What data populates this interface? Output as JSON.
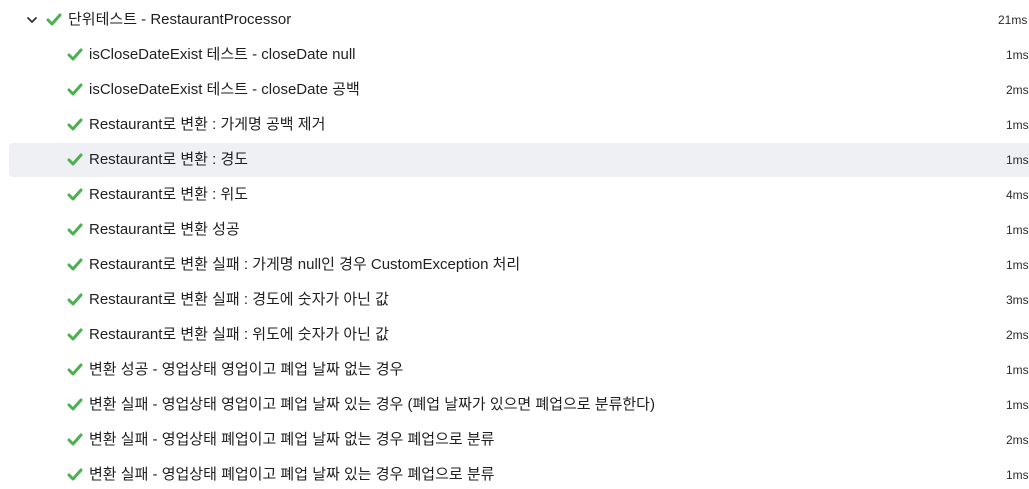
{
  "suite": {
    "title": "단위테스트 - RestaurantProcessor",
    "duration": "21ms",
    "status": "passed",
    "expanded": true
  },
  "tests": [
    {
      "name": "isCloseDateExist 테스트 - closeDate null",
      "duration": "1ms",
      "status": "passed"
    },
    {
      "name": "isCloseDateExist 테스트 - closeDate 공백",
      "duration": "2ms",
      "status": "passed"
    },
    {
      "name": "Restaurant로 변환 : 가게명 공백 제거",
      "duration": "1ms",
      "status": "passed"
    },
    {
      "name": "Restaurant로 변환 : 경도",
      "duration": "1ms",
      "status": "passed",
      "selected": true
    },
    {
      "name": "Restaurant로 변환 : 위도",
      "duration": "4ms",
      "status": "passed"
    },
    {
      "name": "Restaurant로 변환 성공",
      "duration": "1ms",
      "status": "passed"
    },
    {
      "name": "Restaurant로 변환 실패 : 가게명 null인 경우 CustomException 처리",
      "duration": "1ms",
      "status": "passed"
    },
    {
      "name": "Restaurant로 변환 실패 : 경도에 숫자가 아닌 값",
      "duration": "3ms",
      "status": "passed"
    },
    {
      "name": "Restaurant로 변환 실패 : 위도에 숫자가 아닌 값",
      "duration": "2ms",
      "status": "passed"
    },
    {
      "name": "변환 성공 - 영업상태 영업이고 폐업 날짜 없는 경우",
      "duration": "1ms",
      "status": "passed"
    },
    {
      "name": "변환 실패 - 영업상태 영업이고 폐업 날짜 있는 경우 (폐업 날짜가 있으면 폐업으로 분류한다)",
      "duration": "1ms",
      "status": "passed"
    },
    {
      "name": "변환 실패 - 영업상태 폐업이고 폐업 날짜 없는 경우 폐업으로 분류",
      "duration": "2ms",
      "status": "passed"
    },
    {
      "name": "변환 실패 - 영업상태 폐업이고 폐업 날짜 있는 경우 폐업으로 분류",
      "duration": "1ms",
      "status": "passed"
    }
  ],
  "colors": {
    "pass": "#4caf50",
    "selected_row": "#eef0f3",
    "text": "#1f1f1f"
  },
  "icons": {
    "expand": "chevron-down-icon",
    "pass": "check-icon"
  }
}
